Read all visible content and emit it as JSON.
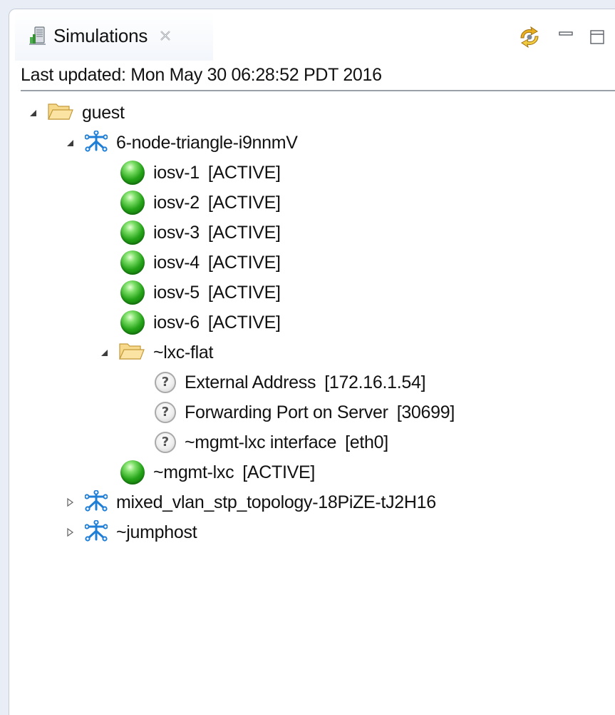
{
  "view": {
    "tab_title": "Simulations",
    "tab_icon": "simulations-server-icon",
    "tab_close_icon": "close-icon",
    "toolbar": [
      {
        "name": "refresh-icon"
      },
      {
        "name": "minimize-icon"
      },
      {
        "name": "maximize-icon"
      }
    ]
  },
  "last_updated": "Last updated: Mon May 30 06:28:52 PDT 2016",
  "tree": {
    "root": {
      "label": "guest",
      "icon": "folder-open-icon",
      "expanded": true
    },
    "topology1": {
      "label": "6-node-triangle-i9nnmV",
      "icon": "topology-icon",
      "expanded": true
    },
    "nodes": [
      {
        "name": "iosv-1",
        "status": "[ACTIVE]"
      },
      {
        "name": "iosv-2",
        "status": "[ACTIVE]"
      },
      {
        "name": "iosv-3",
        "status": "[ACTIVE]"
      },
      {
        "name": "iosv-4",
        "status": "[ACTIVE]"
      },
      {
        "name": "iosv-5",
        "status": "[ACTIVE]"
      },
      {
        "name": "iosv-6",
        "status": "[ACTIVE]"
      }
    ],
    "subfolder": {
      "label": "~lxc-flat",
      "icon": "folder-open-icon",
      "expanded": true
    },
    "props": [
      {
        "name": "External Address",
        "value": "[172.16.1.54]"
      },
      {
        "name": "Forwarding Port on Server",
        "value": "[30699]"
      },
      {
        "name": "~mgmt-lxc interface",
        "value": "[eth0]"
      }
    ],
    "mgmt_node": {
      "name": "~mgmt-lxc",
      "status": "[ACTIVE]"
    },
    "topology2": {
      "label": "mixed_vlan_stp_topology-18PiZE-tJ2H16",
      "icon": "topology-icon",
      "expanded": false
    },
    "topology3": {
      "label": "~jumphost",
      "icon": "topology-icon",
      "expanded": false
    }
  },
  "colors": {
    "active_led": "#25a318",
    "folder": "#f0c060",
    "topology": "#1f7fd6",
    "background": "#e8edf6"
  }
}
